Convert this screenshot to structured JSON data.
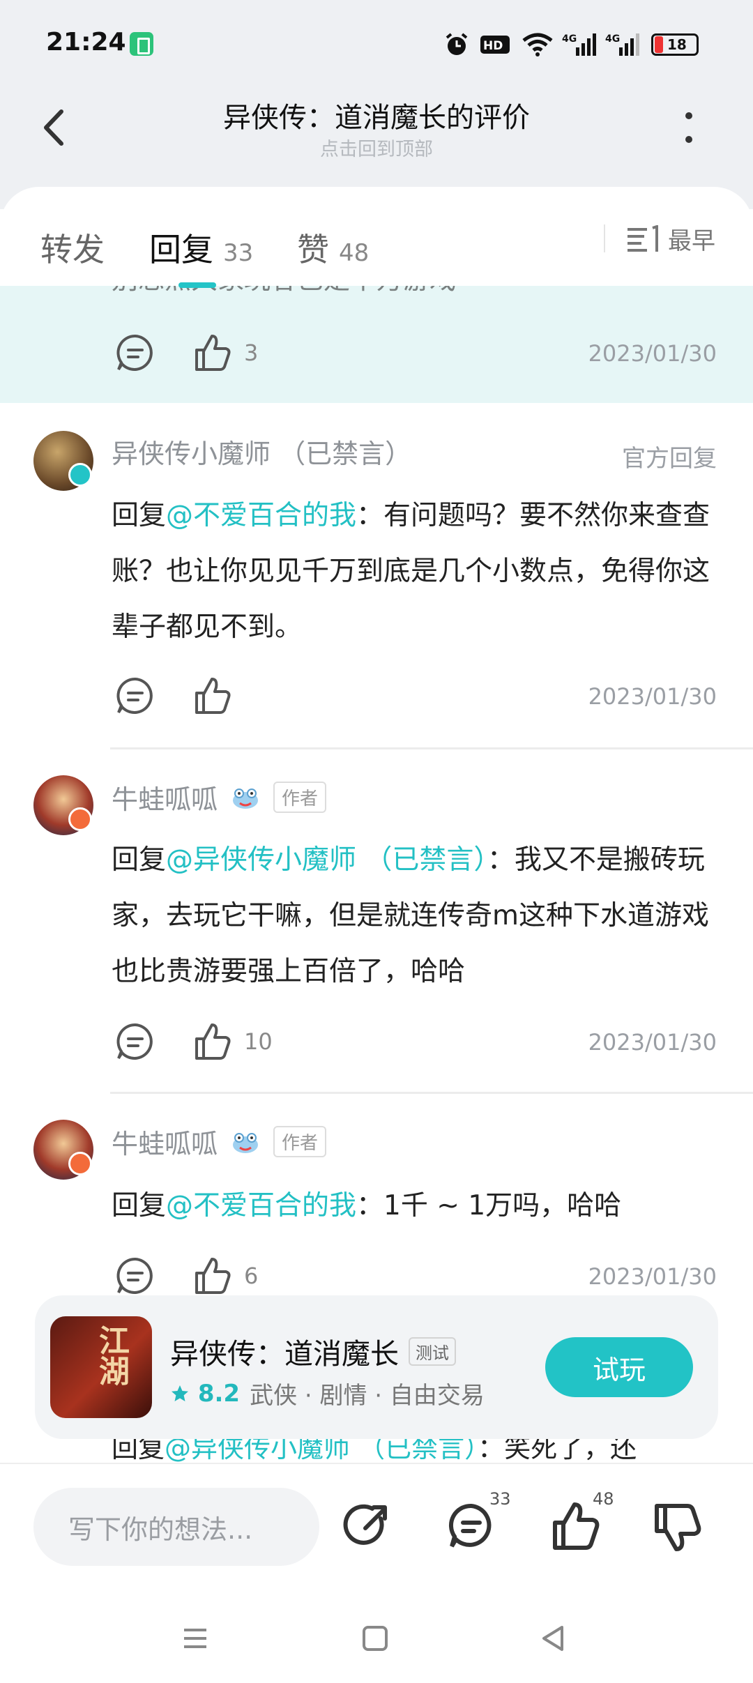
{
  "status_bar": {
    "time": "21:24",
    "battery_level": "18"
  },
  "header": {
    "title": "异侠传：道消魔长的评价",
    "subtitle": "点击回到顶部"
  },
  "tabs": {
    "forward": {
      "label": "转发"
    },
    "reply": {
      "label": "回复",
      "count": "33"
    },
    "like": {
      "label": "赞",
      "count": "48"
    },
    "sort_label": "最早"
  },
  "highlighted": {
    "partial_text": "别忘点大家玩谷已是千万游戏",
    "likes": "3",
    "date": "2023/01/30"
  },
  "comments": [
    {
      "username": "异侠传小魔师 （已禁言）",
      "tag": "官方回复",
      "prefix": "回复",
      "mention": "@不爱百合的我",
      "text": "：有问题吗？要不然你来查查账？也让你见见千万到底是几个小数点，免得你这辈子都见不到。",
      "likes": "",
      "date": "2023/01/30"
    },
    {
      "username": "牛蛙呱呱",
      "tag": "作者",
      "prefix": "回复",
      "mention": "@异侠传小魔师 （已禁言）",
      "text": "：我又不是搬砖玩家，去玩它干嘛，但是就连传奇m这种下水道游戏也比贵游要强上百倍了，哈哈",
      "likes": "10",
      "date": "2023/01/30"
    },
    {
      "username": "牛蛙呱呱",
      "tag": "作者",
      "prefix": "回复",
      "mention": "@不爱百合的我",
      "text": "：1千 ~ 1万吗，哈哈",
      "likes": "6",
      "date": "2023/01/30"
    }
  ],
  "game_card": {
    "cover_text": "江湖",
    "name": "异侠传：道消魔长",
    "test_tag": "测试",
    "score": "8.2",
    "genres": "武侠 · 剧情 · 自由交易",
    "button": "试玩"
  },
  "peek_next": {
    "prefix": "回复",
    "mention": "@异侠传小魔师 （已禁言）",
    "text": "：笑死了，还"
  },
  "bottom_bar": {
    "input_placeholder": "写下你的想法...",
    "comment_count": "33",
    "like_count": "48"
  },
  "colors": {
    "accent": "#23c4c7",
    "highlight_bg": "#e6f6f6"
  }
}
